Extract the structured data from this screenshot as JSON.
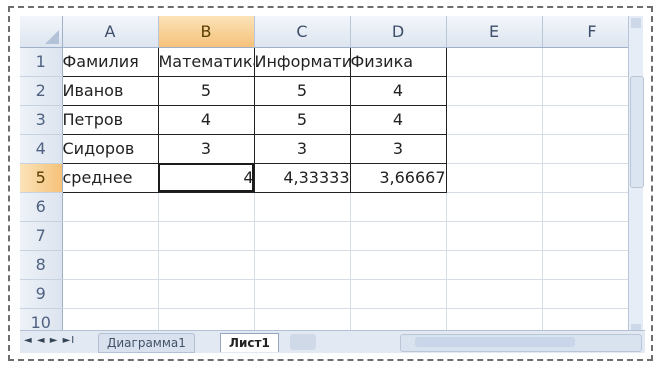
{
  "columns": [
    "A",
    "B",
    "C",
    "D",
    "E",
    "F"
  ],
  "selected_column": "B",
  "rows": [
    {
      "n": "1",
      "cells": [
        "Фамилия",
        "Математика",
        "Информатика",
        "Физика",
        "",
        ""
      ]
    },
    {
      "n": "2",
      "cells": [
        "Иванов",
        "5",
        "5",
        "4",
        "",
        ""
      ]
    },
    {
      "n": "3",
      "cells": [
        "Петров",
        "4",
        "5",
        "4",
        "",
        ""
      ]
    },
    {
      "n": "4",
      "cells": [
        "Сидоров",
        "3",
        "3",
        "3",
        "",
        ""
      ]
    },
    {
      "n": "5",
      "cells": [
        "среднее",
        "4",
        "4,33333",
        "3,66667",
        "",
        ""
      ]
    },
    {
      "n": "6",
      "cells": [
        "",
        "",
        "",
        "",
        "",
        ""
      ]
    },
    {
      "n": "7",
      "cells": [
        "",
        "",
        "",
        "",
        "",
        ""
      ]
    },
    {
      "n": "8",
      "cells": [
        "",
        "",
        "",
        "",
        "",
        ""
      ]
    },
    {
      "n": "9",
      "cells": [
        "",
        "",
        "",
        "",
        "",
        ""
      ]
    },
    {
      "n": "10",
      "cells": [
        "",
        "",
        "",
        "",
        "",
        ""
      ]
    }
  ],
  "selected_row": "5",
  "tabs": {
    "nav": "◄ ◄ ► ►I",
    "sheet1": "Диаграмма1",
    "sheet2": "Лист1"
  }
}
